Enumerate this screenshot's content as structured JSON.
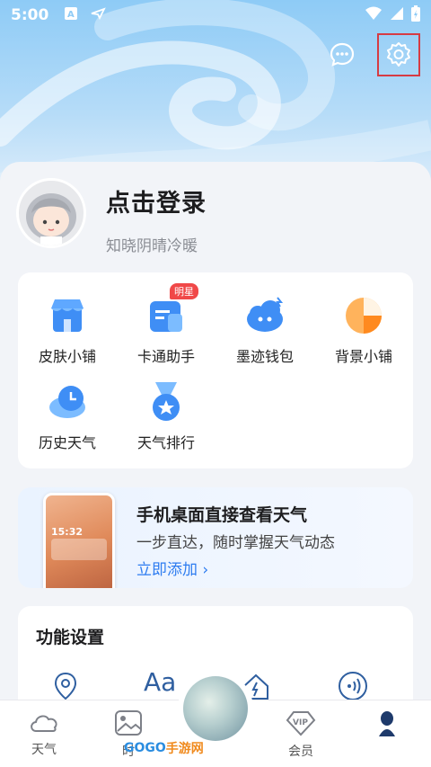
{
  "status_bar": {
    "time": "5:00"
  },
  "profile": {
    "login_text": "点击登录",
    "motto": "知晓阴晴冷暖"
  },
  "services": [
    {
      "label": "皮肤小铺",
      "icon": "shop-icon"
    },
    {
      "label": "卡通助手",
      "icon": "assistant-card-icon",
      "badge": "明星"
    },
    {
      "label": "墨迹钱包",
      "icon": "wallet-cloud-icon"
    },
    {
      "label": "背景小铺",
      "icon": "background-pie-icon"
    },
    {
      "label": "历史天气",
      "icon": "history-cloud-icon"
    },
    {
      "label": "天气排行",
      "icon": "ranking-medal-icon"
    }
  ],
  "promo": {
    "title": "手机桌面直接查看天气",
    "subtitle": "一步直达，随时掌握天气动态",
    "link": "立即添加 ›",
    "phone_time": "15:32"
  },
  "function_settings": {
    "title": "功能设置"
  },
  "bottom_nav": {
    "weather": "天气",
    "photo": "时",
    "vip": "会员"
  },
  "watermark": {
    "main": "GOGO",
    "sub": "手游网"
  },
  "colors": {
    "accent_blue": "#2d7cf0",
    "badge_red": "#f04848",
    "highlight_box": "#d63b43"
  }
}
